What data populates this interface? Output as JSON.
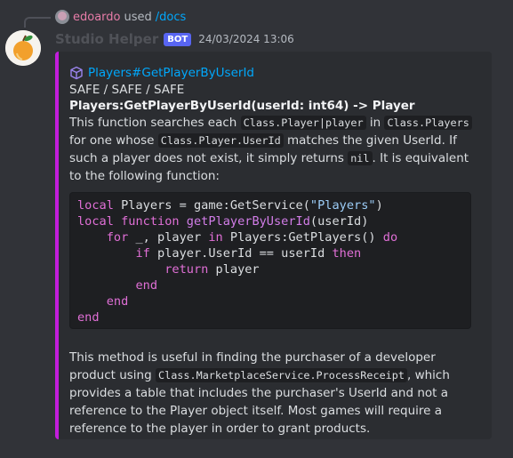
{
  "reply": {
    "username": "edoardo",
    "used": "used",
    "command": "/docs"
  },
  "message": {
    "bot_name": "Studio Helper",
    "badge": "BOT",
    "timestamp": "24/03/2024 13:06"
  },
  "embed": {
    "accent_color": "#c21ddb",
    "author": "Players#GetPlayerByUserId",
    "tags": "SAFE / SAFE / SAFE",
    "title": "Players:GetPlayerByUserId(userId: int64) -> Player",
    "desc1": {
      "t1": "This function searches each ",
      "c1": "Class.Player|player",
      "t2": " in ",
      "c2": "Class.Players",
      "t3": " for one whose ",
      "c3": "Class.Player.UserId",
      "t4": " matches the given UserId. If such a player does not exist, it simply returns ",
      "c4": "nil",
      "t5": ". It is equivalent to the following function:"
    },
    "code": {
      "l1": {
        "k1": "local",
        "a": " Players = game:GetService(",
        "s": "\"Players\"",
        "b": ")"
      },
      "l2": {
        "k1": "local",
        "sp": " ",
        "k2": "function",
        "sp2": " ",
        "fn": "getPlayerByUserId",
        "a": "(userId)"
      },
      "l3": {
        "ind": "    ",
        "k1": "for",
        "a": " _, player ",
        "k2": "in",
        "b": " Players:GetPlayers() ",
        "k3": "do"
      },
      "l4": {
        "ind": "        ",
        "k1": "if",
        "a": " player.UserId == userId ",
        "k2": "then"
      },
      "l5": {
        "ind": "            ",
        "k1": "return",
        "a": " player"
      },
      "l6": {
        "ind": "        ",
        "k1": "end"
      },
      "l7": {
        "ind": "    ",
        "k1": "end"
      },
      "l8": {
        "k1": "end"
      }
    },
    "desc2": {
      "t1": "This method is useful in finding the purchaser of a developer product using ",
      "c1": "Class.MarketplaceService.ProcessReceipt",
      "t2": ", which provides a table that includes the purchaser's UserId and not a reference to the Player object itself. Most games will require a reference to the player in order to grant products."
    }
  }
}
